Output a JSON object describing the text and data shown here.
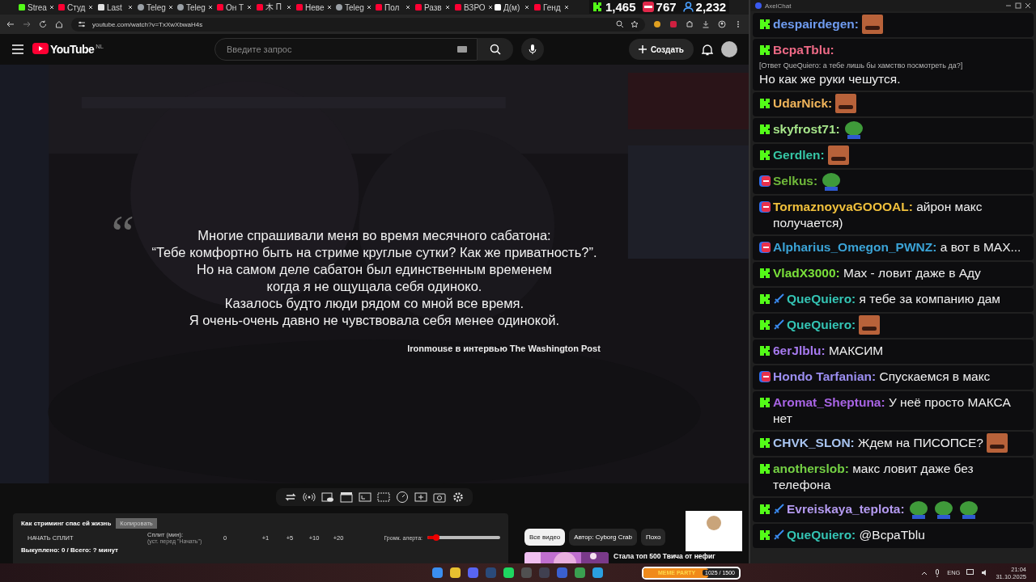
{
  "browser": {
    "tabs": [
      {
        "label": "Strea",
        "kind": "kick"
      },
      {
        "label": "Студ",
        "kind": "youtube"
      },
      {
        "label": "Last",
        "kind": "di"
      },
      {
        "label": "Teleg",
        "kind": "globe"
      },
      {
        "label": "Teleg",
        "kind": "globe"
      },
      {
        "label": "Он Т",
        "kind": "youtube"
      },
      {
        "label": "木 П",
        "kind": "youtube"
      },
      {
        "label": "Неве",
        "kind": "youtube"
      },
      {
        "label": "Teleg",
        "kind": "globe"
      },
      {
        "label": "Пол",
        "kind": "youtube"
      },
      {
        "label": "Разв",
        "kind": "youtube"
      },
      {
        "label": "ВЗРО",
        "kind": "youtube"
      },
      {
        "label": "Д(м)",
        "kind": "tiktok"
      },
      {
        "label": "Генд",
        "kind": "youtube"
      }
    ],
    "viewer_counters": [
      {
        "kind": "kick",
        "count": "1,465"
      },
      {
        "kind": "live",
        "count": "767"
      },
      {
        "kind": "person",
        "count": "2,232"
      }
    ],
    "address": "youtube.com/watch?v=TxXwXbwaH4s"
  },
  "youtube": {
    "logo": "YouTube",
    "region": "NL",
    "search_placeholder": "Введите запрос",
    "create_button": "Создать"
  },
  "video": {
    "quote_mark": "“",
    "quote_lines": [
      "Многие спрашивали меня во время месячного сабатона:",
      "“Тебе комфортно быть на стриме круглые сутки? Как же приватность?”.",
      "Но на самом деле сабатон был единственным временем",
      "когда я не ощущала себя одиноко.",
      "Казалось будто люди рядом со мной все время.",
      "Я очень-очень давно не чувствовала себя менее одинокой."
    ],
    "attribution": "Ironmouse в интервью The Washington Post"
  },
  "panel": {
    "title": "Как стриминг спас ей жизнь",
    "copy_button": "Копировать",
    "start_button": "НАЧАТЬ СПЛИТ",
    "split_label": "Сплит (мин):",
    "split_hint": "(уст. перед \"Начать\")",
    "split_value": "0",
    "increments": [
      "+1",
      "+5",
      "+10",
      "+20"
    ],
    "volume_label": "Громк. алерта:",
    "volume": {
      "level": 0.12
    },
    "bought": "Выкуплено: 0 / Всего: ? минут"
  },
  "related": {
    "chips": [
      {
        "label": "Все видео",
        "selected": true
      },
      {
        "label": "Автор: Cyborg Crab",
        "selected": false
      },
      {
        "label": "Похо",
        "selected": false
      }
    ],
    "video_title": "Стала топ 500 Твича от нефиг"
  },
  "chat": {
    "title": "AxelChat",
    "messages": [
      {
        "kind": "kick",
        "badge": false,
        "name": "despairdegen:",
        "color": "#6f9cf0",
        "emotes": [
          {
            "kind": "face"
          }
        ]
      },
      {
        "kind": "kick",
        "badge": false,
        "name": "BcpaTblu:",
        "color": "#ee6a86",
        "reply": "[Ответ QueQuiero: а тебе лишь бы хамство посмотреть да?]",
        "text": "Но как же руки чешутся."
      },
      {
        "kind": "kick",
        "badge": false,
        "name": "UdarNick:",
        "color": "#f0b45a",
        "emotes": [
          {
            "kind": "face"
          }
        ]
      },
      {
        "kind": "kick",
        "badge": false,
        "name": "skyfrost71:",
        "color": "#a6e58a",
        "emotes": [
          {
            "kind": "frog"
          }
        ]
      },
      {
        "kind": "kick",
        "badge": false,
        "name": "Gerdlen:",
        "color": "#36c6a6",
        "emotes": [
          {
            "kind": "face"
          }
        ]
      },
      {
        "kind": "live",
        "badge": false,
        "name": "Selkus:",
        "color": "#6fb83a",
        "emotes": [
          {
            "kind": "frog"
          }
        ]
      },
      {
        "kind": "live",
        "badge": false,
        "name": "TormaznoyvaGOOOAL:",
        "color": "#f0c03c",
        "text": "айрон макс получается)"
      },
      {
        "kind": "live",
        "badge": false,
        "name": "Alpharius_Omegon_PWNZ:",
        "color": "#3ba3d6",
        "text": "а вот в MAX..."
      },
      {
        "kind": "kick",
        "badge": false,
        "name": "VladX3000:",
        "color": "#7ae03a",
        "text": "Max - ловит даже в Аду"
      },
      {
        "kind": "kick",
        "badge": true,
        "name": "QueQuiero:",
        "color": "#34c4b4",
        "text": "я тебе за компанию дам"
      },
      {
        "kind": "kick",
        "badge": true,
        "name": "QueQuiero:",
        "color": "#34c4b4",
        "emotes": [
          {
            "kind": "face"
          }
        ]
      },
      {
        "kind": "kick",
        "badge": false,
        "name": "6erJlblu:",
        "color": "#a77af0",
        "text": "МАКСИМ"
      },
      {
        "kind": "live",
        "badge": false,
        "name": "Hondo Tarfanian:",
        "color": "#9b8ef0",
        "text": "Спускаемся в макс"
      },
      {
        "kind": "kick",
        "badge": false,
        "name": "Aromat_Sheptuna:",
        "color": "#a864e4",
        "text": "У неё просто МАКСА нет"
      },
      {
        "kind": "kick",
        "badge": false,
        "name": "CHVK_SLON:",
        "color": "#a8c4f0",
        "text": "Ждем на ПИСОПСЕ?",
        "emotes": [
          {
            "kind": "face"
          }
        ]
      },
      {
        "kind": "kick",
        "badge": false,
        "name": "anotherslob:",
        "color": "#74d044",
        "text": "макс ловит даже без телефона"
      },
      {
        "kind": "kick",
        "badge": true,
        "name": "Evreiskaya_teplota:",
        "color": "#b49af0",
        "emotes": [
          {
            "kind": "frog"
          },
          {
            "kind": "frog"
          },
          {
            "kind": "frog"
          }
        ]
      },
      {
        "kind": "kick",
        "badge": true,
        "name": "QueQuiero:",
        "color": "#34c4b4",
        "text": "@BcpaTblu"
      }
    ]
  },
  "taskbar": {
    "apps": [
      {
        "color": "#3a8ef0"
      },
      {
        "color": "#e8c030"
      },
      {
        "color": "#5865f2"
      },
      {
        "color": "#2a4a7a"
      },
      {
        "color": "#1ed760"
      },
      {
        "color": "#505050"
      },
      {
        "color": "#404050"
      },
      {
        "color": "#3a60d0"
      },
      {
        "color": "#3aa050"
      },
      {
        "color": "#2aa0e0"
      }
    ],
    "widget": {
      "title": "MEME PARTY",
      "progress": "1025 / 1500",
      "level": 0.68
    },
    "language": "ENG",
    "time": "21:04",
    "date": "31.10.2025"
  }
}
